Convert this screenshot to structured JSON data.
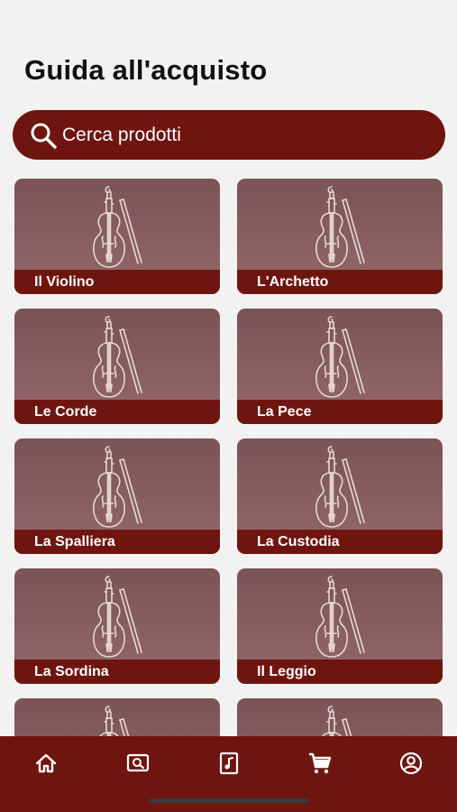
{
  "header": {
    "title": "Guida all'acquisto"
  },
  "search": {
    "placeholder": "Cerca prodotti",
    "icon": "search-icon"
  },
  "categories": [
    {
      "label": "Il Violino"
    },
    {
      "label": "L'Archetto"
    },
    {
      "label": "Le Corde"
    },
    {
      "label": "La Pece"
    },
    {
      "label": "La Spalliera"
    },
    {
      "label": "La Custodia"
    },
    {
      "label": "La Sordina"
    },
    {
      "label": "Il Leggio"
    },
    {
      "label": ""
    },
    {
      "label": ""
    }
  ],
  "tabbar": {
    "items": [
      {
        "icon": "home-icon"
      },
      {
        "icon": "search-screen-icon"
      },
      {
        "icon": "music-sheet-icon"
      },
      {
        "icon": "cart-icon"
      },
      {
        "icon": "account-icon"
      }
    ]
  },
  "colors": {
    "accent": "#6e1510",
    "card_top": "#7b5456",
    "card_bottom": "#94686a",
    "background": "#f2f2f2"
  }
}
